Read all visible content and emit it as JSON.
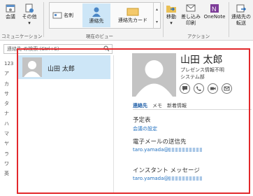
{
  "ribbon": {
    "buttons": {
      "meeting": "会議",
      "other": "その他",
      "move": "移動",
      "mail_merge_1": "差し込み",
      "mail_merge_2": "印刷",
      "onenote": "OneNote",
      "forward_1": "連絡先の",
      "forward_2": "転送"
    },
    "views": [
      "名刺",
      "連絡先",
      "連絡先カード"
    ],
    "groups": {
      "communication": "コミュニケーション",
      "current_view": "現在のビュー",
      "actions": "アクション"
    }
  },
  "search": {
    "placeholder": "連絡先 の検索 (Ctrl+E)"
  },
  "alphabet": [
    "123",
    "ア",
    "カ",
    "サ",
    "タ",
    "ナ",
    "ハ",
    "マ",
    "ヤ",
    "ラ",
    "ワ",
    "英"
  ],
  "contact_list": [
    {
      "name": "山田 太郎"
    }
  ],
  "card": {
    "name": "山田 太郎",
    "presence": "プレゼンス情報不明",
    "company": "システム部",
    "tabs": [
      "連絡先",
      "メモ",
      "新着情報"
    ],
    "active_tab": 0,
    "sections": {
      "schedule_title": "予定表",
      "schedule_link": "会議の設定",
      "email_title": "電子メールの送信先",
      "email_value": "taro.yamada@",
      "im_title": "インスタント メッセージ",
      "im_value": "taro.yamada@"
    }
  },
  "colors": {
    "highlight": "#cde6f7",
    "accent": "#1f6fbf",
    "frame": "#e2282b"
  }
}
